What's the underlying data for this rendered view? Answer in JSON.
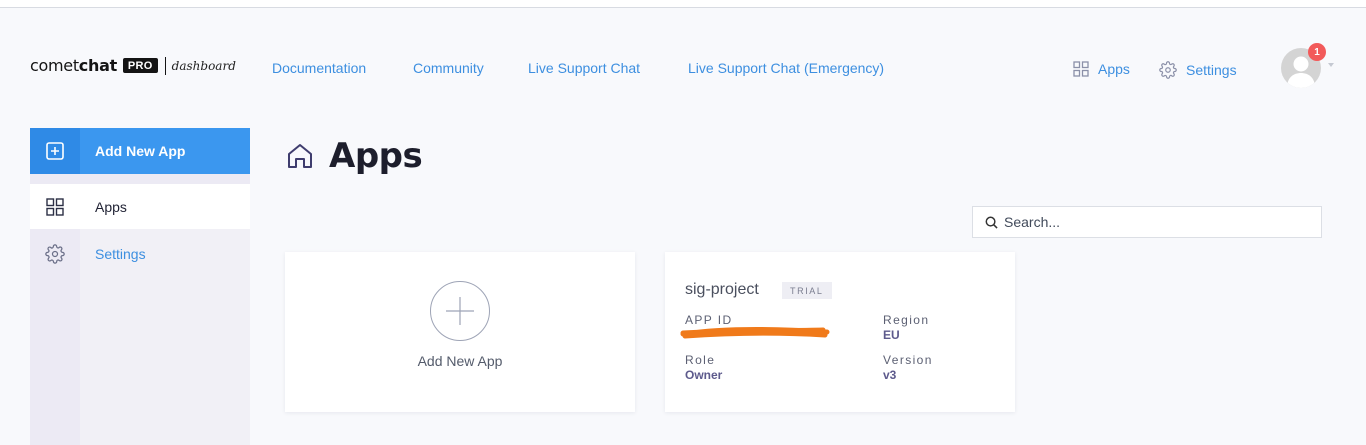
{
  "brand": {
    "name_light": "comet",
    "name_bold": "chat",
    "badge": "PRO",
    "subtitle": "dashboard"
  },
  "nav": {
    "links": [
      "Documentation",
      "Community",
      "Live Support Chat",
      "Live Support Chat (Emergency)"
    ],
    "apps_label": "Apps",
    "settings_label": "Settings",
    "notification_count": "1"
  },
  "sidebar": {
    "add_label": "Add New App",
    "items": [
      {
        "label": "Apps",
        "icon": "grid-icon",
        "active": true
      },
      {
        "label": "Settings",
        "icon": "gear-icon",
        "active": false
      }
    ]
  },
  "main": {
    "title": "Apps",
    "search_placeholder": "Search...",
    "add_card_label": "Add New App",
    "apps": [
      {
        "name": "sig-project",
        "badge": "TRIAL",
        "app_id_label": "APP ID",
        "region_label": "Region",
        "region": "EU",
        "role_label": "Role",
        "role": "Owner",
        "version_label": "Version",
        "version": "v3"
      }
    ]
  },
  "colors": {
    "accent": "#3d8fe0",
    "sidebar_active": "#3b97ef",
    "badge": "#f25a5a",
    "redaction": "#f07a1a"
  }
}
